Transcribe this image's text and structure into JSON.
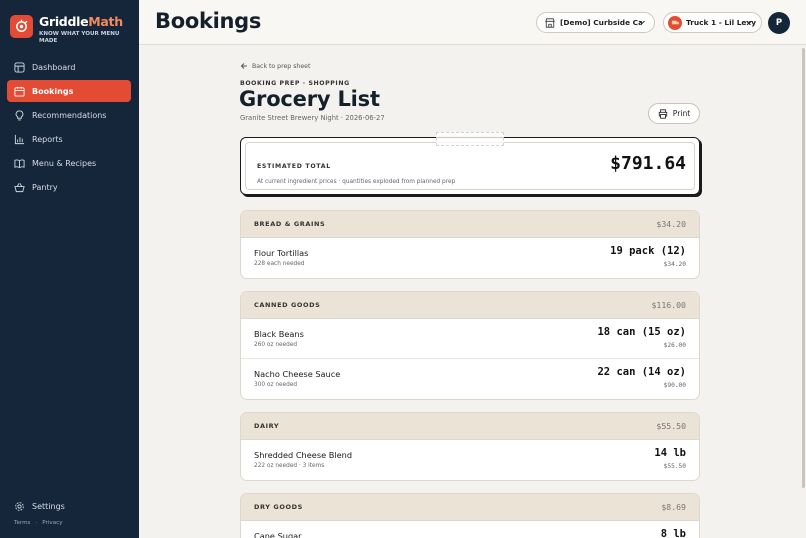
{
  "brand": {
    "name_main": "Griddle",
    "name_accent": "Math",
    "tagline": "KNOW WHAT YOUR MENU MADE"
  },
  "nav": [
    {
      "label": "Dashboard",
      "icon": "dashboard-icon",
      "active": false
    },
    {
      "label": "Bookings",
      "icon": "calendar-icon",
      "active": true
    },
    {
      "label": "Recommendations",
      "icon": "lightbulb-icon",
      "active": false
    },
    {
      "label": "Reports",
      "icon": "bar-chart-icon",
      "active": false
    },
    {
      "label": "Menu & Recipes",
      "icon": "book-icon",
      "active": false
    },
    {
      "label": "Pantry",
      "icon": "basket-icon",
      "active": false
    }
  ],
  "settings_label": "Settings",
  "footer": {
    "terms": "Terms",
    "separator": "·",
    "privacy": "Privacy"
  },
  "header": {
    "title": "Bookings",
    "location": "[Demo] Curbside Canteen",
    "truck": "Truck 1 - Lil Lexy",
    "avatar_initial": "P"
  },
  "page": {
    "back": "Back to prep sheet",
    "eyebrow": "BOOKING PREP · SHOPPING",
    "title": "Grocery List",
    "subtitle": "Granite Street Brewery Night · 2026-06-27",
    "print": "Print"
  },
  "total": {
    "label": "ESTIMATED TOTAL",
    "value": "$791.64",
    "note": "At current ingredient prices · quantities exploded from planned prep"
  },
  "sections": [
    {
      "name": "Bread & Grains",
      "total": "$34.20",
      "items": [
        {
          "name": "Flour Tortillas",
          "sub": "228 each needed",
          "qty": "19 pack (12)",
          "cost": "$34.20"
        }
      ]
    },
    {
      "name": "Canned Goods",
      "total": "$116.00",
      "items": [
        {
          "name": "Black Beans",
          "sub": "260 oz needed",
          "qty": "18 can (15 oz)",
          "cost": "$26.00"
        },
        {
          "name": "Nacho Cheese Sauce",
          "sub": "300 oz needed",
          "qty": "22 can (14 oz)",
          "cost": "$90.00"
        }
      ]
    },
    {
      "name": "Dairy",
      "total": "$55.50",
      "items": [
        {
          "name": "Shredded Cheese Blend",
          "sub": "222 oz needed · 3 items",
          "qty": "14 lb",
          "cost": "$55.50"
        }
      ]
    },
    {
      "name": "Dry Goods",
      "total": "$8.69",
      "items": [
        {
          "name": "Cane Sugar",
          "sub": "",
          "qty": "8 lb",
          "cost": ""
        }
      ]
    }
  ],
  "colors": {
    "accent": "#e44b35",
    "sidebar": "#15263a",
    "section_header": "#ebe4d6"
  }
}
